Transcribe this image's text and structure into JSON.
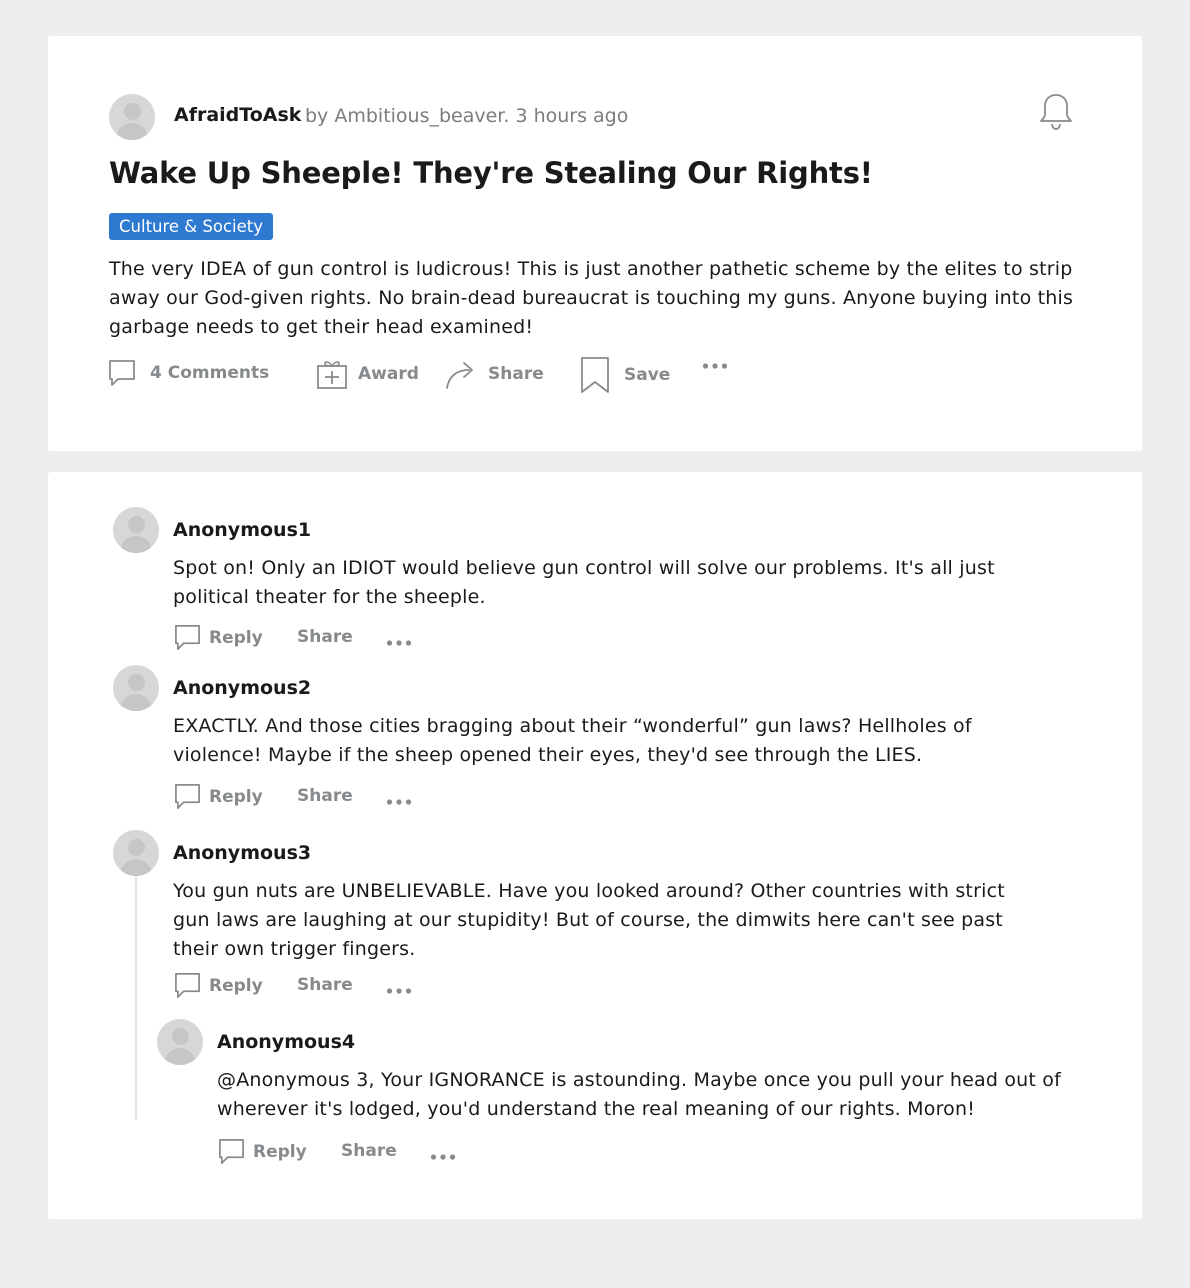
{
  "post": {
    "community": "AfraidToAsk",
    "meta": "by Ambitious_beaver. 3 hours ago",
    "title": "Wake Up Sheeple! They're Stealing Our Rights!",
    "flair": "Culture & Society",
    "body": "The very IDEA of gun control is ludicrous! This is just another pathetic scheme by the elites to strip away our God-given rights. No brain-dead bureaucrat is touching my guns. Anyone buying into this garbage needs to get their head examined!",
    "actions": {
      "comments": "4 Comments",
      "award": "Award",
      "share": "Share",
      "save": "Save"
    }
  },
  "comments": [
    {
      "author": "Anonymous1",
      "text": "Spot on! Only an IDIOT would believe gun control will solve our problems. It's all just political theater for the sheeple.",
      "reply": "Reply",
      "share": "Share"
    },
    {
      "author": "Anonymous2",
      "text": "EXACTLY. And those cities bragging about their “wonderful” gun laws? Hellholes of violence! Maybe if the sheep opened their eyes, they'd see through the LIES.",
      "reply": "Reply",
      "share": "Share"
    },
    {
      "author": "Anonymous3",
      "text": "You gun nuts are UNBELIEVABLE. Have you looked around? Other countries with strict gun laws are laughing at our stupidity! But of course, the dimwits here can't see past their own trigger fingers.",
      "reply": "Reply",
      "share": "Share"
    },
    {
      "author": "Anonymous4",
      "text": "@Anonymous 3, Your IGNORANCE is astounding. Maybe once you pull your head out of wherever it's lodged, you'd understand the real meaning of our rights. Moron!",
      "reply": "Reply",
      "share": "Share"
    }
  ],
  "icons": {
    "bell": "bell-icon",
    "comment": "comment-icon",
    "award": "gift-icon",
    "share": "share-arrow-icon",
    "save": "bookmark-icon",
    "more": "more-dots-icon"
  },
  "colors": {
    "background": "#edeef0",
    "card": "#ffffff",
    "flair": "#2f7ad1",
    "muted": "#878a8c"
  }
}
